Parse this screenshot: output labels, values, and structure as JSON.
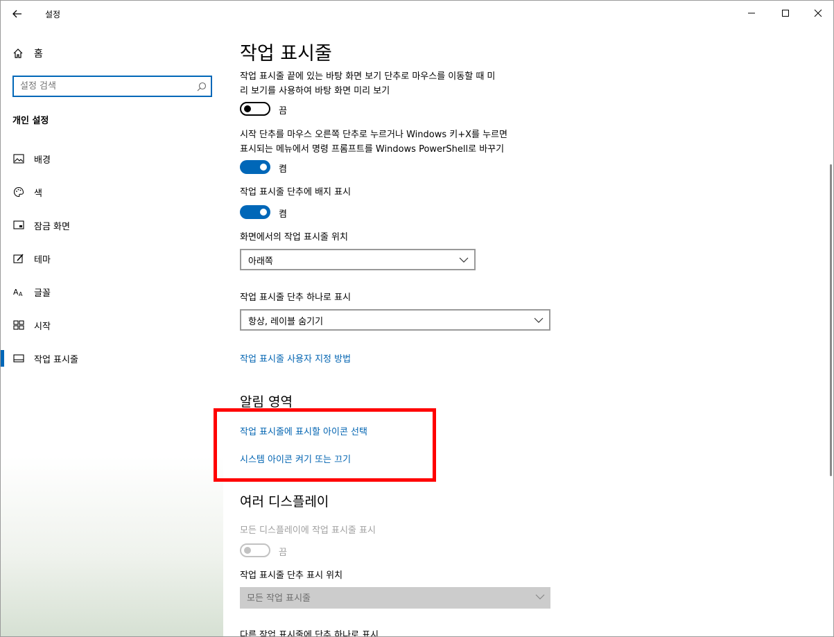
{
  "window": {
    "title": "설정"
  },
  "sidebar": {
    "home_label": "홈",
    "search_placeholder": "설정 검색",
    "section_title": "개인 설정",
    "items": [
      {
        "label": "배경",
        "icon": "image-icon"
      },
      {
        "label": "색",
        "icon": "palette-icon"
      },
      {
        "label": "잠금 화면",
        "icon": "lock-screen-icon"
      },
      {
        "label": "테마",
        "icon": "theme-brush-icon"
      },
      {
        "label": "글꼴",
        "icon": "font-icon"
      },
      {
        "label": "시작",
        "icon": "start-menu-icon"
      },
      {
        "label": "작업 표시줄",
        "icon": "taskbar-icon",
        "active": true
      }
    ]
  },
  "main": {
    "title": "작업 표시줄",
    "peek_desc_line1": "작업 표시줄 끝에 있는 바탕 화면 보기 단추로 마우스를 이동할 때 미",
    "peek_desc_line2": "리 보기를 사용하여 바탕 화면 미리 보기",
    "peek_state": "끔",
    "powershell_desc_line1": "시작 단추를 마우스 오른쪽 단추로 누르거나 Windows 키+X를 누르면",
    "powershell_desc_line2": "표시되는 메뉴에서 명령 프롬프트를 Windows PowerShell로 바꾸기",
    "powershell_state": "켬",
    "badge_desc": "작업 표시줄 단추에 배지 표시",
    "badge_state": "켬",
    "position_label": "화면에서의 작업 표시줄 위치",
    "position_value": "아래쪽",
    "combine_label": "작업 표시줄 단추 하나로 표시",
    "combine_value": "항상, 레이블 숨기기",
    "customize_link": "작업 표시줄 사용자 지정 방법",
    "notification_heading": "알림 영역",
    "select_icons_link": "작업 표시줄에 표시할 아이콘 선택",
    "system_icons_link": "시스템 아이콘 켜기 또는 끄기",
    "multi_heading": "여러 디스플레이",
    "multi_show_desc": "모든 디스플레이에 작업 표시줄 표시",
    "multi_show_state": "끔",
    "multi_position_label": "작업 표시줄 단추 표시 위치",
    "multi_position_value": "모든 작업 표시줄",
    "multi_combine_label_partial": "다른 작업 표시줄에 단추 하나로 표시"
  },
  "colors": {
    "accent": "#0067b8",
    "link": "#0063b1",
    "highlight": "#ff0000"
  }
}
